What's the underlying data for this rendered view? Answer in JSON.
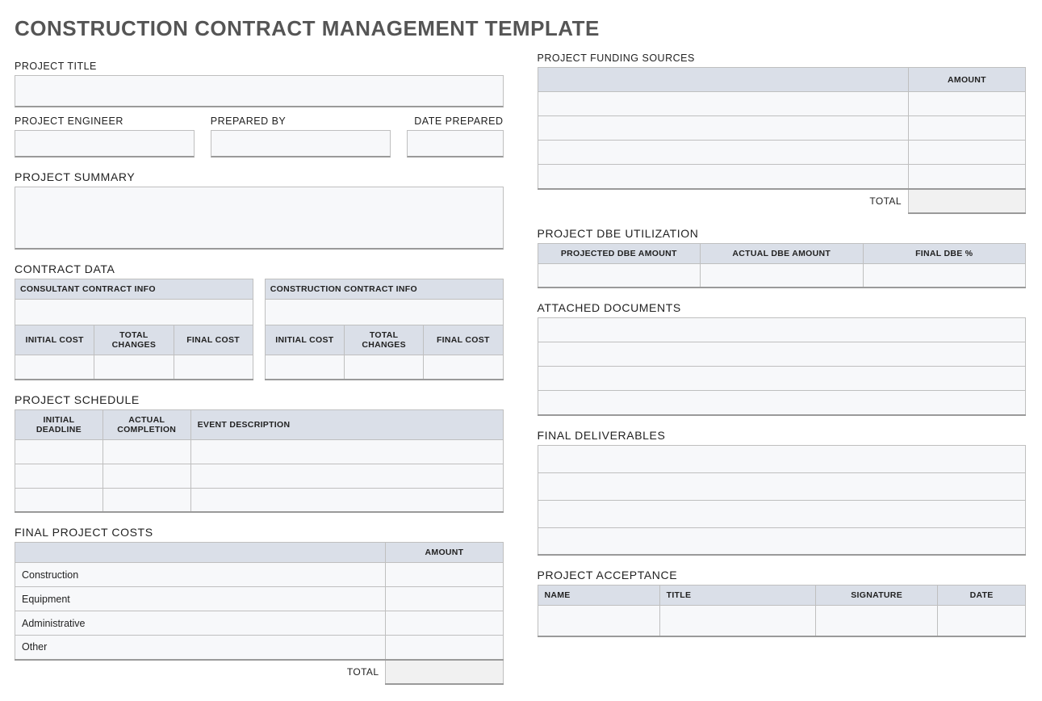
{
  "title": "CONSTRUCTION CONTRACT MANAGEMENT TEMPLATE",
  "left": {
    "project_title_label": "PROJECT TITLE",
    "project_engineer_label": "PROJECT ENGINEER",
    "prepared_by_label": "PREPARED BY",
    "date_prepared_label": "DATE PREPARED",
    "project_summary_label": "PROJECT SUMMARY",
    "contract_data_label": "CONTRACT DATA",
    "consultant_header": "CONSULTANT CONTRACT INFO",
    "construction_header": "CONSTRUCTION CONTRACT INFO",
    "initial_cost": "INITIAL COST",
    "total_changes": "TOTAL CHANGES",
    "final_cost": "FINAL COST",
    "project_schedule_label": "PROJECT SCHEDULE",
    "initial_deadline": "INITIAL DEADLINE",
    "actual_completion": "ACTUAL COMPLETION",
    "event_description": "EVENT DESCRIPTION",
    "final_project_costs_label": "FINAL PROJECT COSTS",
    "amount": "AMOUNT",
    "cost_rows": [
      "Construction",
      "Equipment",
      "Administrative",
      "Other"
    ],
    "total": "TOTAL"
  },
  "right": {
    "funding_sources_label": "PROJECT FUNDING SOURCES",
    "amount": "AMOUNT",
    "total": "TOTAL",
    "dbe_label": "PROJECT DBE UTILIZATION",
    "projected_dbe": "PROJECTED DBE AMOUNT",
    "actual_dbe": "ACTUAL DBE AMOUNT",
    "final_dbe_pct": "FINAL DBE %",
    "attached_docs_label": "ATTACHED DOCUMENTS",
    "final_deliverables_label": "FINAL DELIVERABLES",
    "project_acceptance_label": "PROJECT ACCEPTANCE",
    "name": "NAME",
    "title": "TITLE",
    "signature": "SIGNATURE",
    "date": "DATE"
  }
}
